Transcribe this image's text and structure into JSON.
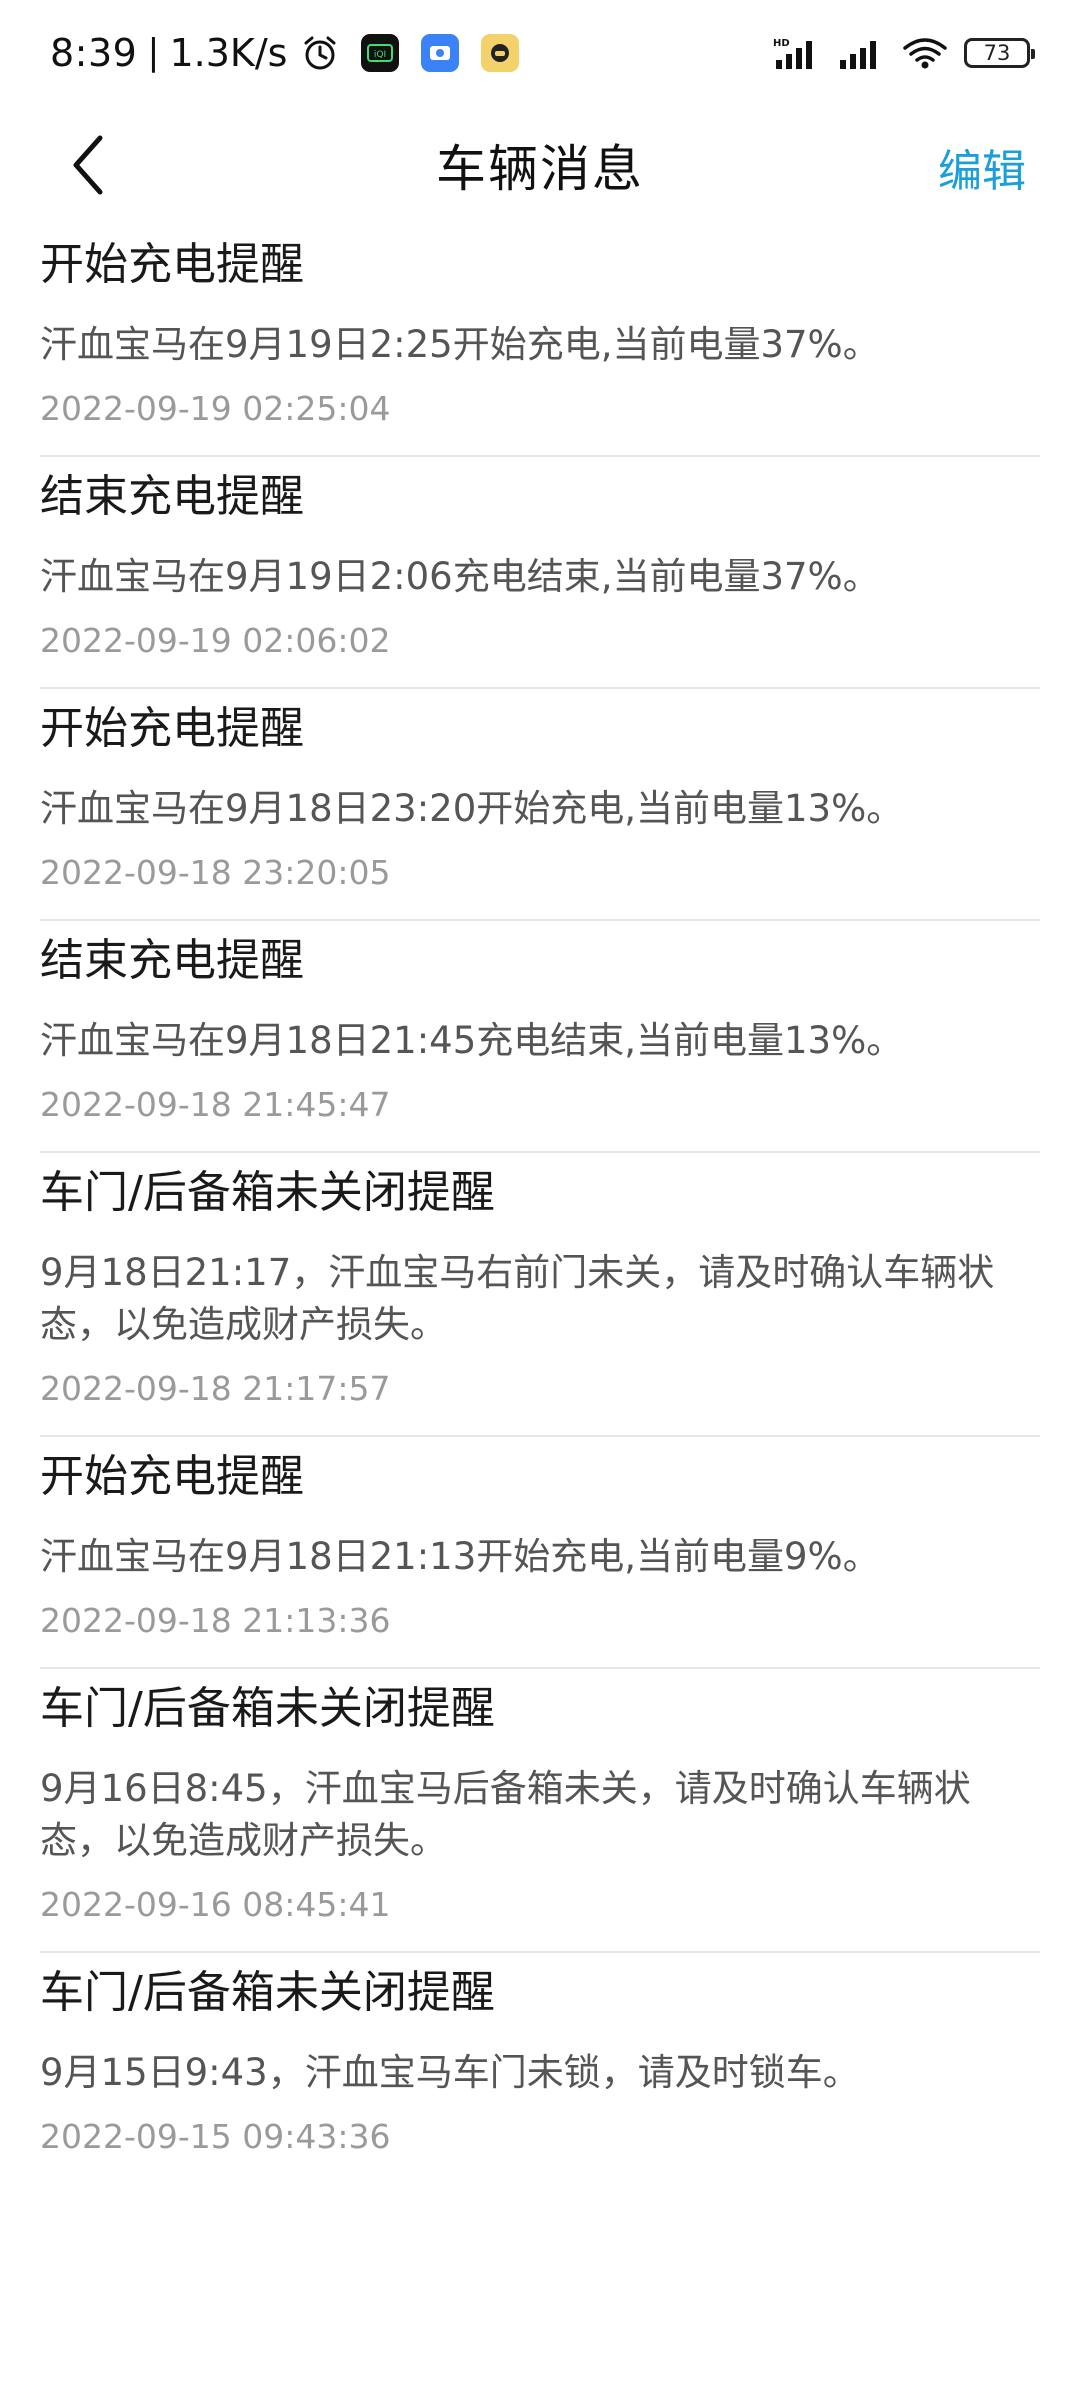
{
  "status_bar": {
    "time": "8:39",
    "separator": "|",
    "speed": "1.3K/s",
    "battery": "73",
    "icons": [
      "alarm-icon",
      "iqiyi-app-icon",
      "maps-app-icon",
      "taxi-app-icon",
      "hd-signal-icon",
      "signal-icon",
      "wifi-icon",
      "battery-icon"
    ]
  },
  "header": {
    "title": "车辆消息",
    "edit_label": "编辑",
    "back_icon": "chevron-left-icon"
  },
  "colors": {
    "accent": "#1a9fd8",
    "title": "#1a1a1a",
    "body": "#555555",
    "timestamp": "#9a9a9a",
    "divider": "#e6e6e6"
  },
  "messages": [
    {
      "title": "开始充电提醒",
      "body": "汗血宝马在9月19日2:25开始充电,当前电量37%。",
      "time": "2022-09-19 02:25:04"
    },
    {
      "title": "结束充电提醒",
      "body": "汗血宝马在9月19日2:06充电结束,当前电量37%。",
      "time": "2022-09-19 02:06:02"
    },
    {
      "title": "开始充电提醒",
      "body": "汗血宝马在9月18日23:20开始充电,当前电量13%。",
      "time": "2022-09-18 23:20:05"
    },
    {
      "title": "结束充电提醒",
      "body": "汗血宝马在9月18日21:45充电结束,当前电量13%。",
      "time": "2022-09-18 21:45:47"
    },
    {
      "title": "车门/后备箱未关闭提醒",
      "body": "9月18日21:17，汗血宝马右前门未关，请及时确认车辆状态，以免造成财产损失。",
      "time": "2022-09-18 21:17:57"
    },
    {
      "title": "开始充电提醒",
      "body": "汗血宝马在9月18日21:13开始充电,当前电量9%。",
      "time": "2022-09-18 21:13:36"
    },
    {
      "title": "车门/后备箱未关闭提醒",
      "body": "9月16日8:45，汗血宝马后备箱未关，请及时确认车辆状态，以免造成财产损失。",
      "time": "2022-09-16 08:45:41"
    },
    {
      "title": "车门/后备箱未关闭提醒",
      "body": "9月15日9:43，汗血宝马车门未锁，请及时锁车。",
      "time": "2022-09-15 09:43:36"
    }
  ]
}
